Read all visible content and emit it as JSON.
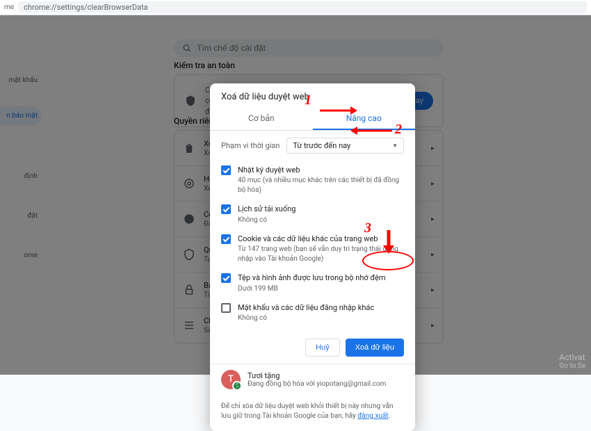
{
  "address_bar": "chrome://settings/clearBrowserData",
  "tab_label": "me",
  "search_placeholder": "Tìm chế độ cài đặt",
  "sections": {
    "safety_title": "Kiểm tra an toàn",
    "privacy_title": "Quyền riêng"
  },
  "sidebar": [
    "mật khẩu",
    "n bảo mật",
    "định",
    "đặt",
    "ome"
  ],
  "safety_card": {
    "text": "Chrome có thể giúp bảo vệ bạn trước các sự cố rò rỉ dữ liệu, tiện ích độc hại và những vấn đề khác",
    "button": "Kiểm tra ngay"
  },
  "priv_items": [
    {
      "title": "Xoá",
      "sub": "Xoá"
    },
    {
      "title": "Hướ",
      "sub": "Xem"
    },
    {
      "title": "Coo",
      "sub": "Đã c"
    },
    {
      "title": "Quy",
      "sub": "Tuỳ"
    },
    {
      "title": "Bảo",
      "sub": "Tính"
    },
    {
      "title": "Chế",
      "sub": "Sắp"
    }
  ],
  "dialog": {
    "title": "Xoá dữ liệu duyệt web",
    "tabs": {
      "basic": "Cơ bản",
      "advanced": "Nâng cao"
    },
    "range_label": "Phạm vi thời gian",
    "range_value": "Từ trước đến nay",
    "items": [
      {
        "checked": true,
        "title": "Nhật ký duyệt web",
        "sub": "40 mục (và nhiều mục khác trên các thiết bị đã đồng bộ hóa)"
      },
      {
        "checked": true,
        "title": "Lịch sử tải xuống",
        "sub": "Không có"
      },
      {
        "checked": true,
        "title": "Cookie và các dữ liệu khác của trang web",
        "sub": "Từ 147 trang web (bạn sẽ vẫn duy trì trạng thái đăng nhập vào Tài khoản Google)"
      },
      {
        "checked": true,
        "title": "Tệp và hình ảnh được lưu trong bộ nhớ đệm",
        "sub": "Dưới 199 MB"
      },
      {
        "checked": false,
        "title": "Mật khẩu và các dữ liệu đăng nhập khác",
        "sub": "Không có"
      }
    ],
    "cancel": "Huỷ",
    "confirm": "Xoá dữ liệu",
    "user": {
      "initial": "T",
      "name": "Tươi tặng",
      "sync": "Đang đồng bộ hóa với yiopotang@gmail.com"
    },
    "footer_text": "Để chỉ xóa dữ liệu duyệt web khỏi thiết bị này nhưng vẫn lưu giữ trong Tài khoản Google của bạn, hãy ",
    "footer_link": "đăng xuất"
  },
  "annotations": {
    "n1": "1",
    "n2": "2",
    "n3": "3"
  },
  "watermark": {
    "l1": "Activat",
    "l2": "Go to Se"
  }
}
